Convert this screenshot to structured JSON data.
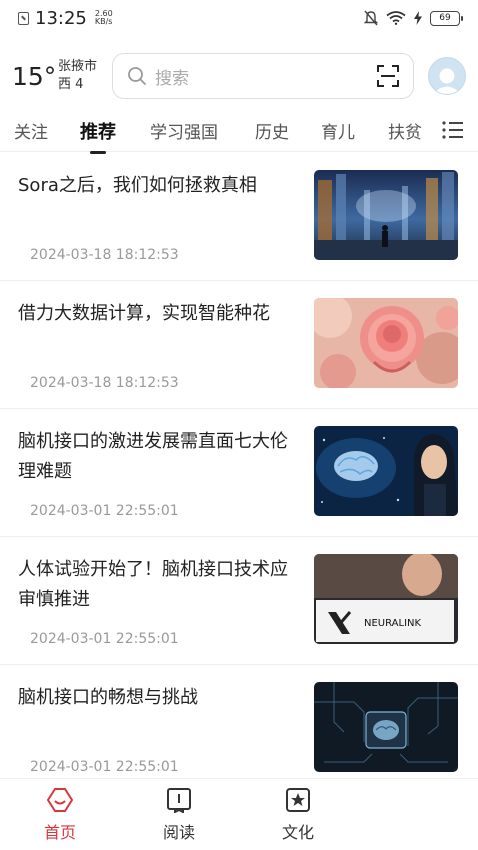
{
  "status": {
    "time": "13:25",
    "speed_value": "2.60",
    "speed_unit": "KB/s",
    "battery": "69"
  },
  "header": {
    "temperature": "15°",
    "city": "张掖市",
    "wind": "西 4",
    "search_placeholder": "搜索"
  },
  "tabs": [
    "关注",
    "推荐",
    "学习强国",
    "历史",
    "育儿",
    "扶贫"
  ],
  "active_tab": "推荐",
  "news": [
    {
      "title": "Sora之后，我们如何拯救真相",
      "time": "2024-03-18 18:12:53",
      "image": "city-figure-thumbnail"
    },
    {
      "title": "借力大数据计算，实现智能种花",
      "time": "2024-03-18 18:12:53",
      "image": "pink-rose-thumbnail"
    },
    {
      "title": "脑机接口的激进发展需直面七大伦理难题",
      "time": "2024-03-01 22:55:01",
      "image": "brain-woman-thumbnail"
    },
    {
      "title": "人体试验开始了！脑机接口技术应审慎推进",
      "time": "2024-03-01 22:55:01",
      "image": "neuralink-thumbnail",
      "image_text": "NEURALINK"
    },
    {
      "title": "脑机接口的畅想与挑战",
      "time": "2024-03-01 22:55:01",
      "image": "circuit-brain-thumbnail"
    }
  ],
  "tabbar": [
    {
      "label": "首页",
      "icon": "home-icon"
    },
    {
      "label": "阅读",
      "icon": "book-icon"
    },
    {
      "label": "文化",
      "icon": "star-icon"
    }
  ],
  "colors": {
    "accent": "#d9363e"
  }
}
